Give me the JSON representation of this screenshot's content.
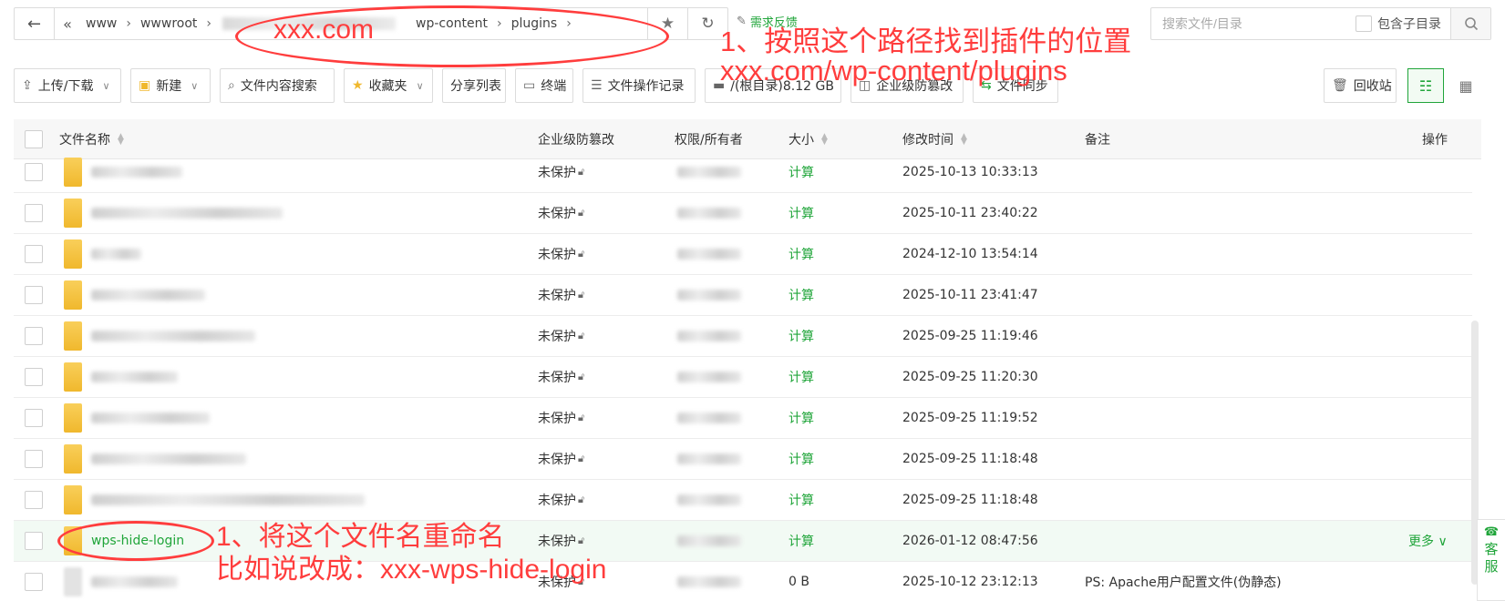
{
  "pathbar": {
    "back_icon": "arrow-left-icon",
    "crumbs": [
      "www",
      "wwwroot",
      "wp-content",
      "plugins"
    ],
    "feedback_label": "需求反馈"
  },
  "search": {
    "placeholder": "搜索文件/目录",
    "include_subdirs_label": "包含子目录"
  },
  "toolbar": {
    "upload_label": "上传/下载",
    "new_label": "新建",
    "content_search_label": "文件内容搜索",
    "favorites_label": "收藏夹",
    "share_list_label": "分享列表",
    "terminal_label": "终端",
    "file_ops_log_label": "文件操作记录",
    "disk_label": "/(根目录)8.12 GB",
    "tamper_label": "企业级防篡改",
    "sync_label": "文件同步",
    "recycle_label": "回收站"
  },
  "table": {
    "headers": {
      "name": "文件名称",
      "tamper": "企业级防篡改",
      "perm": "权限/所有者",
      "size": "大小",
      "mtime": "修改时间",
      "note": "备注",
      "ops": "操作"
    },
    "rows": [
      {
        "name": "",
        "tamper": "未保护",
        "size": "计算",
        "mtime": "2025-10-13 10:33:13",
        "note": "",
        "ops": ""
      },
      {
        "name": "",
        "tamper": "未保护",
        "size": "计算",
        "mtime": "2025-10-11 23:40:22",
        "note": "",
        "ops": ""
      },
      {
        "name": "",
        "tamper": "未保护",
        "size": "计算",
        "mtime": "2024-12-10 13:54:14",
        "note": "",
        "ops": ""
      },
      {
        "name": "",
        "tamper": "未保护",
        "size": "计算",
        "mtime": "2025-10-11 23:41:47",
        "note": "",
        "ops": ""
      },
      {
        "name": "",
        "tamper": "未保护",
        "size": "计算",
        "mtime": "2025-09-25 11:19:46",
        "note": "",
        "ops": ""
      },
      {
        "name": "",
        "tamper": "未保护",
        "size": "计算",
        "mtime": "2025-09-25 11:20:30",
        "note": "",
        "ops": ""
      },
      {
        "name": "",
        "tamper": "未保护",
        "size": "计算",
        "mtime": "2025-09-25 11:19:52",
        "note": "",
        "ops": ""
      },
      {
        "name": "",
        "tamper": "未保护",
        "size": "计算",
        "mtime": "2025-09-25 11:18:48",
        "note": "",
        "ops": ""
      },
      {
        "name": "",
        "tamper": "未保护",
        "size": "计算",
        "mtime": "2025-09-25 11:18:48",
        "note": "",
        "ops": ""
      },
      {
        "name": "wps-hide-login",
        "tamper": "未保护",
        "size": "计算",
        "mtime": "2026-01-12 08:47:56",
        "note": "",
        "ops": "更多"
      },
      {
        "name": "",
        "tamper": "未保护",
        "size": "0 B",
        "mtime": "2025-10-12 23:12:13",
        "note": "PS: Apache用户配置文件(伪静态)",
        "ops": ""
      }
    ]
  },
  "side_service": {
    "line1": "客",
    "line2": "服"
  },
  "annotations": {
    "domain_label": "xxx.com",
    "step1_title": "1、按照这个路径找到插件的位置",
    "step1_path": "xxx.com/wp-content/plugins",
    "step2_title": "1、将这个文件名重命名",
    "step2_example": "比如说改成：xxx-wps-hide-login"
  },
  "colors": {
    "accent": "#20a53a",
    "annotation": "#ff3d3d"
  }
}
